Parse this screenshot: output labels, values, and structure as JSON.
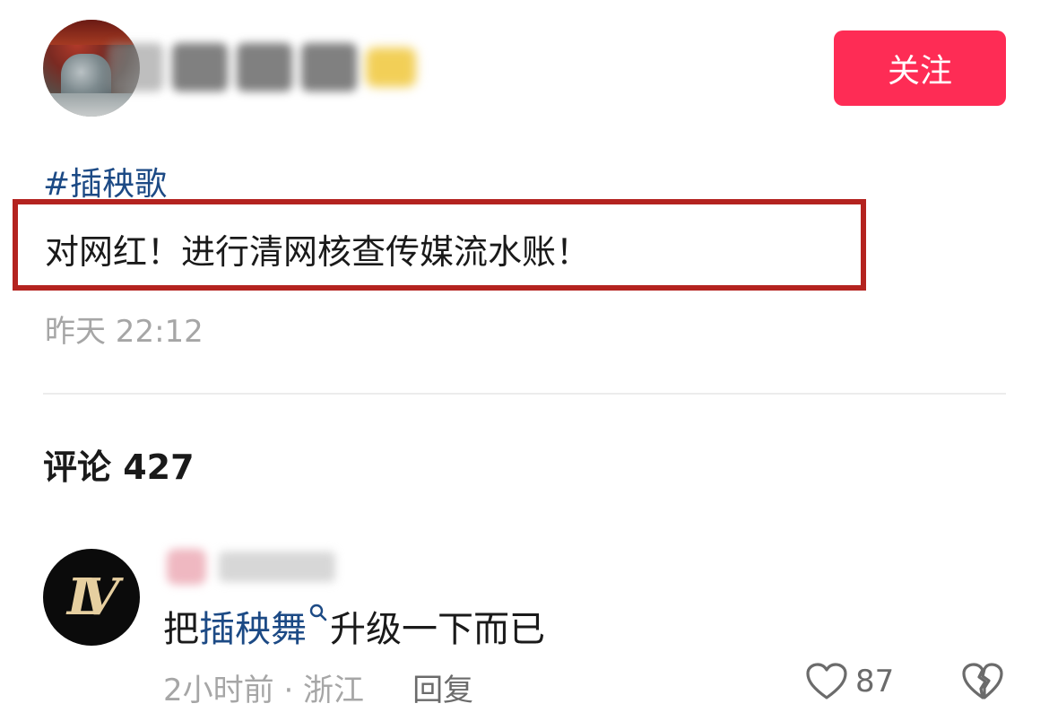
{
  "post": {
    "follow_label": "关注",
    "hashtag": "#插秧歌",
    "text": "对网红！进行清网核查传媒流水账！",
    "time": "昨天 22:12"
  },
  "comments_section": {
    "title": "评论 427"
  },
  "comment": {
    "text_prefix": "把",
    "link_text": "插秧舞",
    "text_suffix": "升级一下而已",
    "meta": "2小时前 · 浙江",
    "reply_label": "回复",
    "like_count": "87",
    "avatar_logo": "LV"
  },
  "colors": {
    "follow_button": "#fe2c55",
    "link": "#1c4a85",
    "highlight_border": "#b4231f",
    "meta_text": "#a6a6a6"
  },
  "icons": [
    "search-icon",
    "heart-icon",
    "broken-heart-icon",
    "crown-icon"
  ]
}
